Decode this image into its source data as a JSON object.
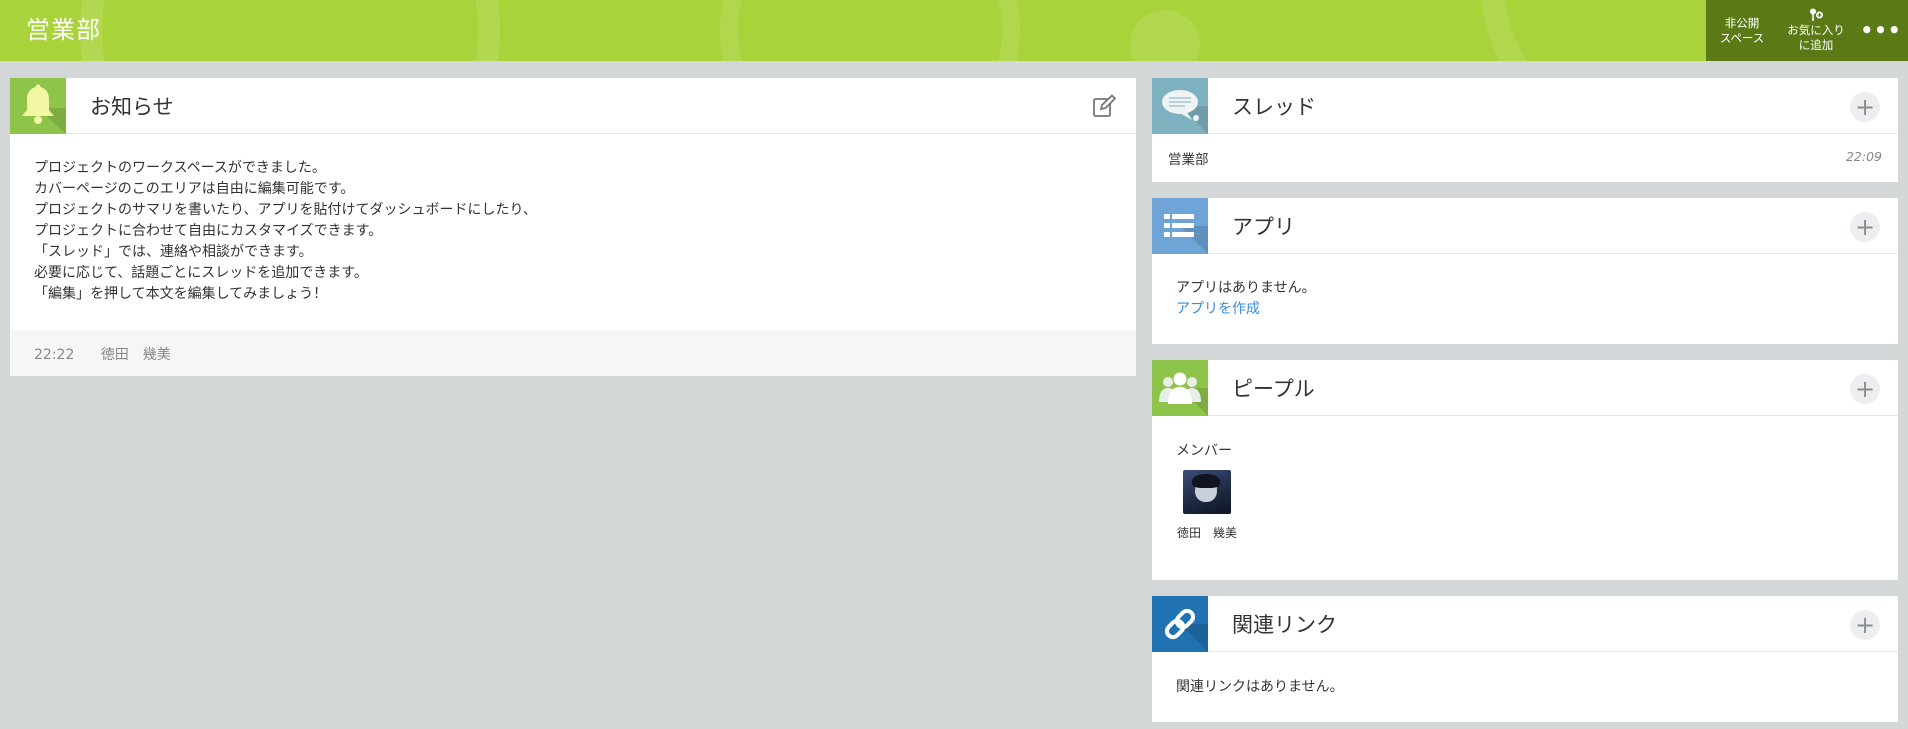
{
  "header": {
    "title": "営業部",
    "private_line1": "非公開",
    "private_line2": "スペース",
    "fav_line1": "お気に入り",
    "fav_line2": "に追加",
    "more": "•••"
  },
  "notice": {
    "title": "お知らせ",
    "lines": [
      "プロジェクトのワークスペースができました。",
      "カバーページのこのエリアは自由に編集可能です。",
      "プロジェクトのサマリを書いたり、アプリを貼付けてダッシュボードにしたり、",
      "プロジェクトに合わせて自由にカスタマイズできます。",
      "「スレッド」では、連絡や相談ができます。",
      "必要に応じて、話題ごとにスレッドを追加できます。",
      "「編集」を押して本文を編集してみましょう！"
    ],
    "time": "22:22",
    "author": "徳田　幾美"
  },
  "thread": {
    "title": "スレッド",
    "items": [
      {
        "name": "営業部",
        "time": "22:09"
      }
    ]
  },
  "apps": {
    "title": "アプリ",
    "empty": "アプリはありません。",
    "create_link": "アプリを作成"
  },
  "people": {
    "title": "ピープル",
    "member_label": "メンバー",
    "members": [
      {
        "name": "徳田　幾美"
      }
    ]
  },
  "links": {
    "title": "関連リンク",
    "empty": "関連リンクはありません。"
  },
  "plus": "+",
  "colors": {
    "header_bg": "#a8d33a",
    "header_actions_bg": "#5b7a16",
    "notice_icon": "#8fc44a",
    "thread_icon": "#7fb2c0",
    "apps_icon": "#6ea5d6",
    "people_icon": "#8fc44a",
    "links_icon": "#2172b3",
    "link_text": "#3a8ed6"
  }
}
